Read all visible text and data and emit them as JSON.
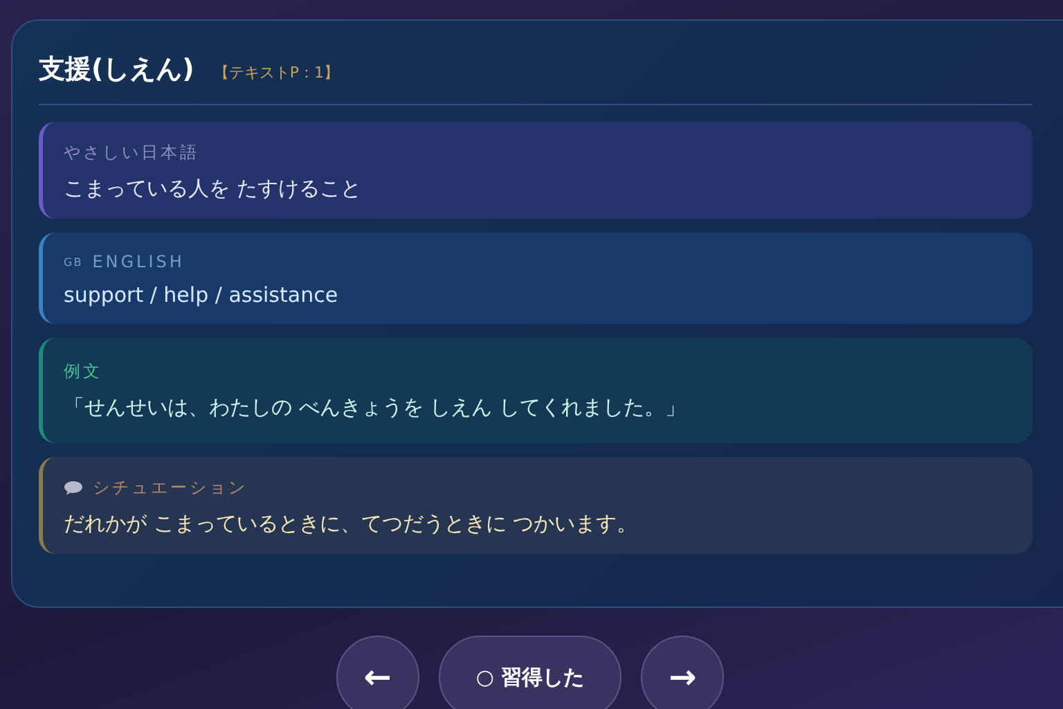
{
  "card": {
    "title": "支援(しえん)",
    "source": "【テキストP：1】",
    "sections": [
      {
        "kind": "japanese",
        "label": "やさしい日本語",
        "text": "こまっている人を たすけること"
      },
      {
        "kind": "english",
        "flag": "GB",
        "label": "ENGLISH",
        "text": "support / help / assistance"
      },
      {
        "kind": "example",
        "label": "例文",
        "text": "「せんせいは、わたしの べんきょうを しえん してくれました。」"
      },
      {
        "kind": "situation",
        "label": "シチュエーション",
        "text": "だれかが こまっているときに、てつだうときに つかいます。"
      }
    ]
  },
  "nav": {
    "prev": "←",
    "learned": "○ 習得した",
    "next": "→"
  }
}
